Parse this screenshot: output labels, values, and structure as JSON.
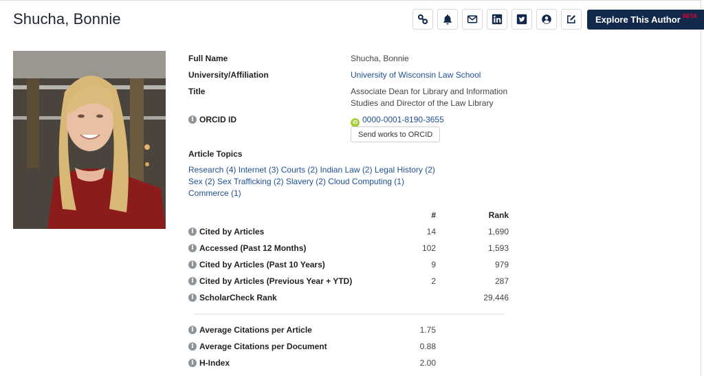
{
  "header": {
    "title": "Shucha, Bonnie",
    "toolbar": {
      "icons": [
        {
          "name": "link-icon",
          "label": "Copy link"
        },
        {
          "name": "bell-icon",
          "label": "Alerts"
        },
        {
          "name": "envelope-icon",
          "label": "Email"
        },
        {
          "name": "linkedin-icon",
          "label": "LinkedIn"
        },
        {
          "name": "twitter-icon",
          "label": "Twitter"
        },
        {
          "name": "user-circle-icon",
          "label": "Profile"
        },
        {
          "name": "edit-icon",
          "label": "Edit"
        }
      ],
      "explore_label": "Explore This Author",
      "explore_badge": "BETA"
    }
  },
  "photo": {
    "alt": "Photo of Bonnie Shucha"
  },
  "profile": {
    "full_name_label": "Full Name",
    "full_name": "Shucha, Bonnie",
    "affiliation_label": "University/Affiliation",
    "affiliation": "University of Wisconsin Law School",
    "title_label": "Title",
    "title_line1": "Associate Dean for Library and Information",
    "title_line2": "Studies and Director of the Law Library",
    "orcid_label": "ORCID ID",
    "orcid_badge": "iD",
    "orcid_id": "0000-0001-8190-3655",
    "send_orcid_label": "Send works to ORCID"
  },
  "topics": {
    "label": "Article Topics",
    "items": [
      "Research (4)",
      "Internet (3)",
      "Courts (2)",
      "Indian Law (2)",
      "Legal History (2)",
      "Sex (2)",
      "Sex Trafficking (2)",
      "Slavery (2)",
      "Cloud Computing (1)",
      "Commerce (1)"
    ]
  },
  "stats": {
    "col_num": "#",
    "col_rank": "Rank",
    "rows": [
      {
        "label": "Cited by Articles",
        "num": "14",
        "rank": "1,690"
      },
      {
        "label": "Accessed (Past 12 Months)",
        "num": "102",
        "rank": "1,593"
      },
      {
        "label": "Cited by Articles (Past 10 Years)",
        "num": "9",
        "rank": "979"
      },
      {
        "label": "Cited by Articles (Previous Year + YTD)",
        "num": "2",
        "rank": "287"
      },
      {
        "label": "ScholarCheck Rank",
        "num": "",
        "rank": "29,446"
      }
    ],
    "averages": [
      {
        "label": "Average Citations per Article",
        "value": "1.75"
      },
      {
        "label": "Average Citations per Document",
        "value": "0.88"
      },
      {
        "label": "H-Index",
        "value": "2.00"
      }
    ]
  },
  "info_glyph": "i"
}
